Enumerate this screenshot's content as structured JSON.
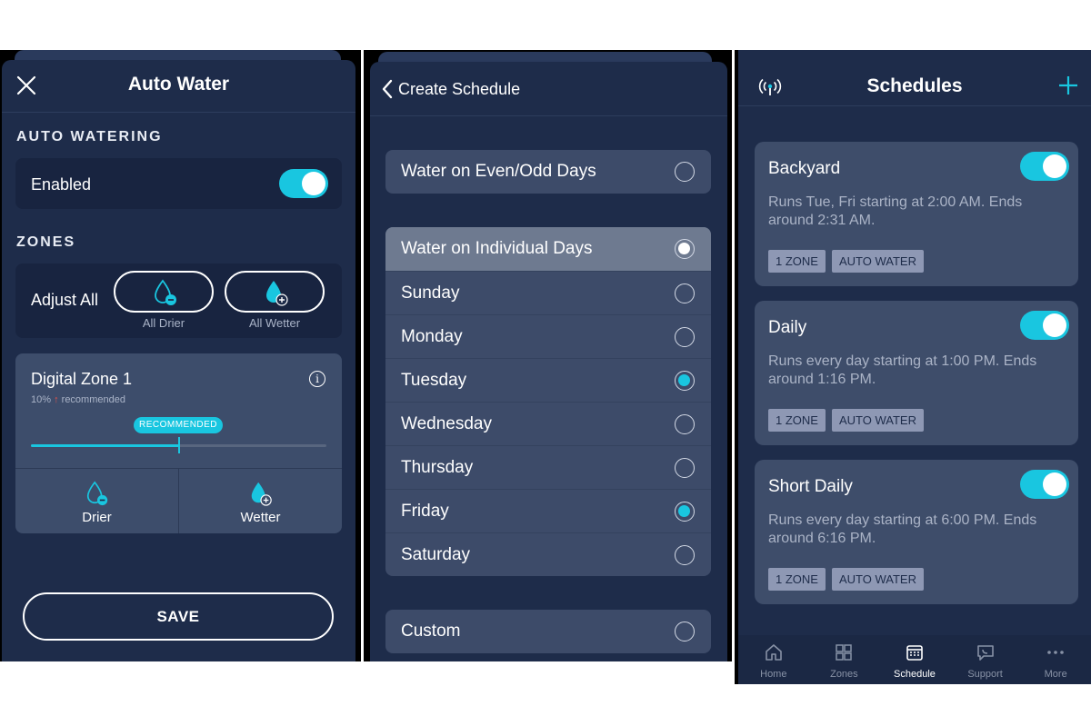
{
  "auto_water": {
    "title": "Auto Water",
    "section_auto": "AUTO WATERING",
    "enabled_label": "Enabled",
    "enabled_on": true,
    "section_zones": "ZONES",
    "adjust_all_label": "Adjust All",
    "all_drier_label": "All Drier",
    "all_wetter_label": "All Wetter",
    "zone": {
      "name": "Digital Zone 1",
      "percent": "10%",
      "recommended_text": "recommended",
      "badge": "RECOMMENDED",
      "slider_fraction": 0.5,
      "drier_label": "Drier",
      "wetter_label": "Wetter"
    },
    "save_label": "SAVE"
  },
  "create_schedule": {
    "title": "Create Schedule",
    "even_odd": {
      "label": "Water on Even/Odd Days",
      "selected": false
    },
    "individual": {
      "label": "Water on Individual Days",
      "selected": true,
      "days": [
        {
          "label": "Sunday",
          "selected": false
        },
        {
          "label": "Monday",
          "selected": false
        },
        {
          "label": "Tuesday",
          "selected": true
        },
        {
          "label": "Wednesday",
          "selected": false
        },
        {
          "label": "Thursday",
          "selected": false
        },
        {
          "label": "Friday",
          "selected": true
        },
        {
          "label": "Saturday",
          "selected": false
        }
      ]
    },
    "custom": {
      "label": "Custom",
      "selected": false
    }
  },
  "schedules": {
    "title": "Schedules",
    "items": [
      {
        "name": "Backyard",
        "desc": "Runs Tue, Fri starting at 2:00 AM. Ends around 2:31 AM.",
        "tags": [
          "1 ZONE",
          "AUTO WATER"
        ],
        "enabled": true
      },
      {
        "name": "Daily",
        "desc": "Runs every day starting at 1:00 PM. Ends around 1:16 PM.",
        "tags": [
          "1 ZONE",
          "AUTO WATER"
        ],
        "enabled": true
      },
      {
        "name": "Short Daily",
        "desc": "Runs every day starting at 6:00 PM. Ends around 6:16 PM.",
        "tags": [
          "1 ZONE",
          "AUTO WATER"
        ],
        "enabled": true
      }
    ],
    "tabs": [
      "Home",
      "Zones",
      "Schedule",
      "Support",
      "More"
    ],
    "active_tab": "Schedule"
  },
  "colors": {
    "accent": "#19c6e0",
    "panel": "#1e2c4a",
    "card": "#3e4d6a",
    "up_arrow": "#e2524a"
  }
}
